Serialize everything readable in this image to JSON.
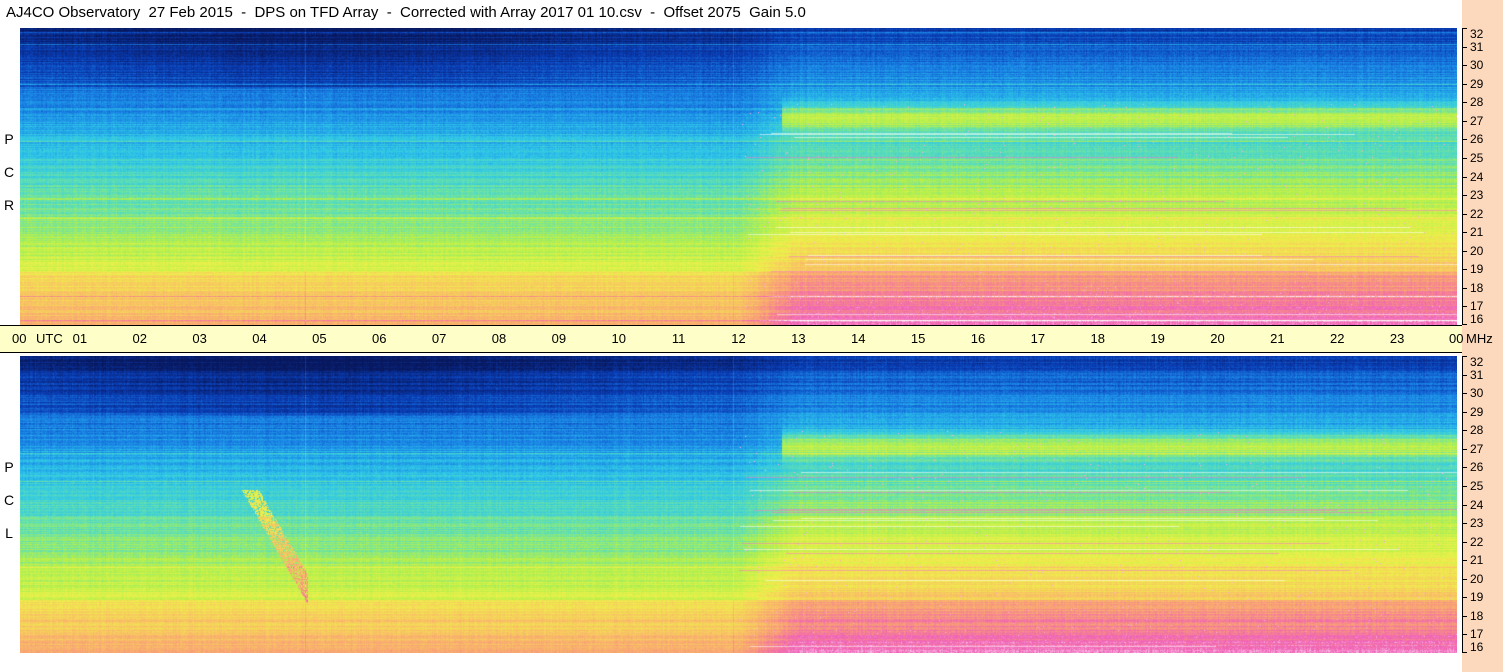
{
  "header": {
    "title": "AJ4CO Observatory  27 Feb 2015  -  DPS on TFD Array  -  Corrected with Array 2017 01 10.csv  -  Offset 2075  Gain 5.0"
  },
  "chart_data": {
    "type": "heatmap",
    "title": "AJ4CO Observatory  27 Feb 2015  -  DPS on TFD Array  -  Corrected with Array 2017 01 10.csv  -  Offset 2075  Gain 5.0",
    "panels": [
      {
        "label_letters": [
          "R",
          "C",
          "P"
        ]
      },
      {
        "label_letters": [
          "L",
          "C",
          "P"
        ]
      }
    ],
    "x_ticks": [
      "00",
      "01",
      "02",
      "03",
      "04",
      "05",
      "06",
      "07",
      "08",
      "09",
      "10",
      "11",
      "12",
      "13",
      "14",
      "15",
      "16",
      "17",
      "18",
      "19",
      "20",
      "21",
      "22",
      "23",
      "00"
    ],
    "x_unit_labels": {
      "start": "UTC",
      "end": "MHz"
    },
    "xlim_hours": [
      0,
      24
    ],
    "y_ticks": [
      "32",
      "31",
      "30",
      "29",
      "28",
      "27",
      "26",
      "25",
      "24",
      "23",
      "22",
      "21",
      "20",
      "19",
      "18",
      "17",
      "16"
    ],
    "ylim_mhz": [
      16,
      32
    ],
    "colormap": [
      "#08185e",
      "#0a3fb8",
      "#1a86e6",
      "#2ec6e8",
      "#62e0b0",
      "#b6f04a",
      "#eef04a",
      "#f8c860",
      "#f89a7a",
      "#f060b8",
      "#ffffff"
    ]
  }
}
